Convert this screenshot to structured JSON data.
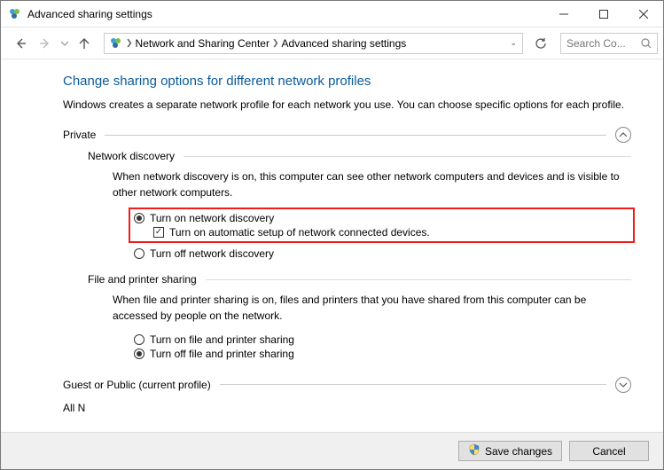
{
  "window": {
    "title": "Advanced sharing settings"
  },
  "breadcrumb": {
    "item1": "Network and Sharing Center",
    "item2": "Advanced sharing settings"
  },
  "search": {
    "placeholder": "Search Co..."
  },
  "page": {
    "heading": "Change sharing options for different network profiles",
    "intro": "Windows creates a separate network profile for each network you use. You can choose specific options for each profile."
  },
  "private": {
    "title": "Private",
    "discovery": {
      "title": "Network discovery",
      "desc": "When network discovery is on, this computer can see other network computers and devices and is visible to other network computers.",
      "on_label": "Turn on network discovery",
      "auto_label": "Turn on automatic setup of network connected devices.",
      "off_label": "Turn off network discovery"
    },
    "fps": {
      "title": "File and printer sharing",
      "desc": "When file and printer sharing is on, files and printers that you have shared from this computer can be accessed by people on the network.",
      "on_label": "Turn on file and printer sharing",
      "off_label": "Turn off file and printer sharing"
    }
  },
  "guest": {
    "title": "Guest or Public (current profile)"
  },
  "allnet": {
    "title_partial": "All N"
  },
  "footer": {
    "save": "Save changes",
    "cancel": "Cancel"
  }
}
